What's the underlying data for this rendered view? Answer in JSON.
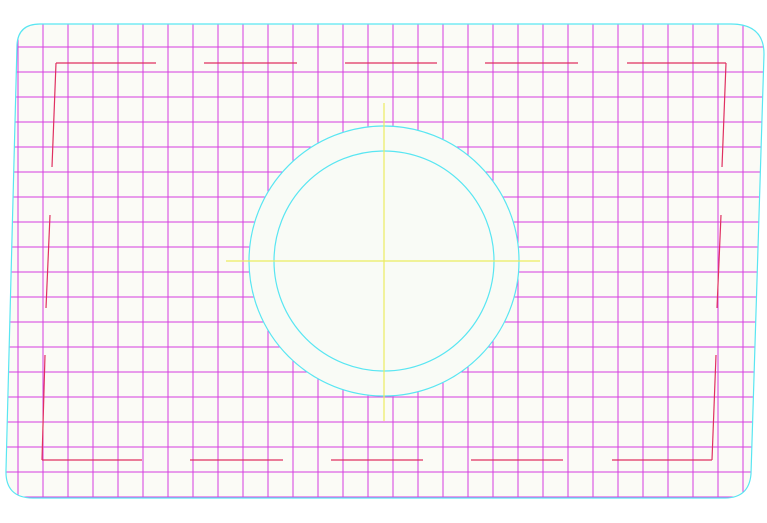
{
  "drawing": {
    "type": "cad-grid-layout",
    "colors": {
      "background": "#ffffff",
      "panel_fill": "#fbfbf6",
      "panel_outline": "#59e6f2",
      "grid_lines": "#d63ee0",
      "edge_lines": "#e03060",
      "circle_outline": "#59e6f2",
      "circle_fill": "#f9fbf6",
      "crosshair": "#ecec60"
    }
  }
}
